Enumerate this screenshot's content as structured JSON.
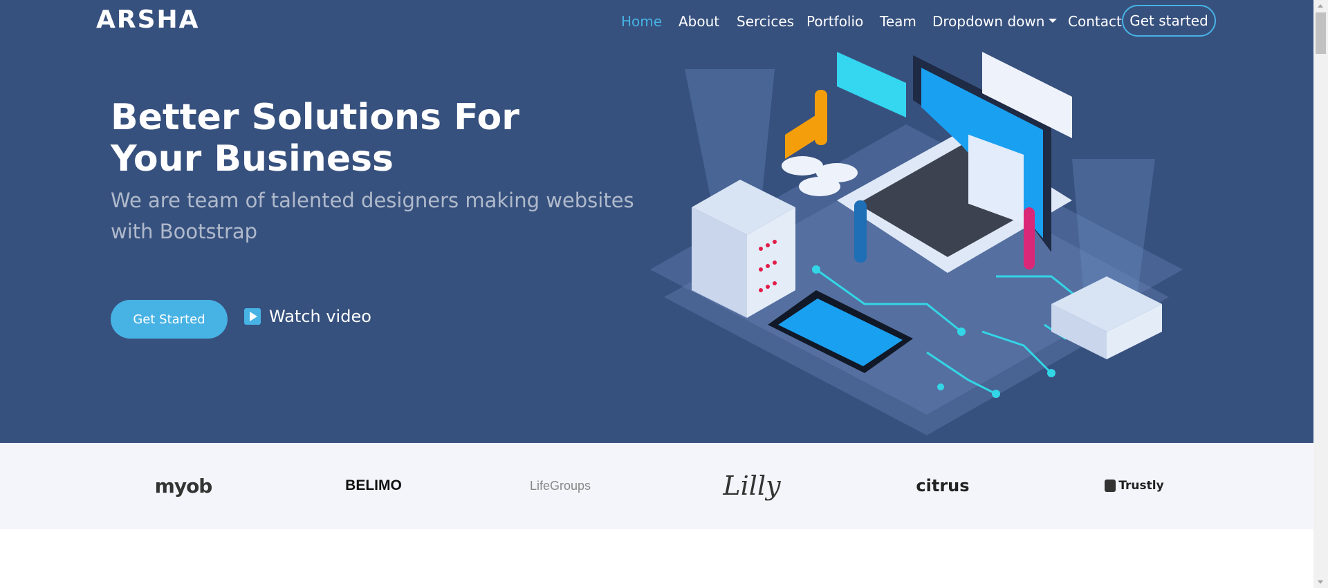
{
  "header": {
    "logo": "ARSHA",
    "nav": [
      {
        "label": "Home",
        "active": true
      },
      {
        "label": "About"
      },
      {
        "label": "Sercices"
      },
      {
        "label": "Portfolio"
      },
      {
        "label": "Team"
      },
      {
        "label": "Dropdown down",
        "has_caret": true
      },
      {
        "label": "Contact"
      }
    ],
    "cta_label": "Get started"
  },
  "hero": {
    "title": "Better Solutions For Your Business",
    "subtitle": "We are team of talented designers making websites with Bootstrap",
    "primary_button": "Get Started",
    "video_link": "Watch video",
    "illustration": "isometric-tech-illustration"
  },
  "clients": [
    "myob",
    "BELIMO",
    "LifeGroups",
    "Lilly",
    "citrus",
    "Trustly"
  ],
  "colors": {
    "hero_bg": "#37517e",
    "accent": "#47b2e4",
    "clients_bg": "#f3f5fa"
  }
}
